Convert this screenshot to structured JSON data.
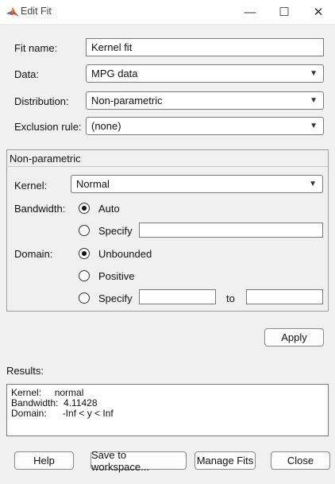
{
  "window": {
    "title": "Edit Fit",
    "minimize_glyph": "—",
    "maximize_glyph": "☐",
    "close_glyph": "✕",
    "app_icon": "matlab-logo-icon",
    "accent_color": "#0078d7"
  },
  "form": {
    "fit_name_label": "Fit name:",
    "fit_name_value": "Kernel fit",
    "data_label": "Data:",
    "data_value": "MPG data",
    "distribution_label": "Distribution:",
    "distribution_value": "Non-parametric",
    "exclusion_label": "Exclusion rule:",
    "exclusion_value": "(none)"
  },
  "nonparametric": {
    "title": "Non-parametric",
    "kernel_label": "Kernel:",
    "kernel_value": "Normal",
    "bandwidth_label": "Bandwidth:",
    "bandwidth_options": [
      "Auto",
      "Specify"
    ],
    "bandwidth_selected": "Auto",
    "bandwidth_specify_value": "",
    "domain_label": "Domain:",
    "domain_options": [
      "Unbounded",
      "Positive",
      "Specify"
    ],
    "domain_selected": "Unbounded",
    "domain_from_value": "",
    "domain_to_label": "to",
    "domain_to_value": ""
  },
  "apply_label": "Apply",
  "results": {
    "label": "Results:",
    "lines": [
      "Kernel:     normal",
      "Bandwidth:  4.11428",
      "Domain:      -Inf < y < Inf"
    ]
  },
  "buttons": {
    "help": "Help",
    "save": "Save to workspace...",
    "manage": "Manage Fits",
    "close": "Close"
  }
}
